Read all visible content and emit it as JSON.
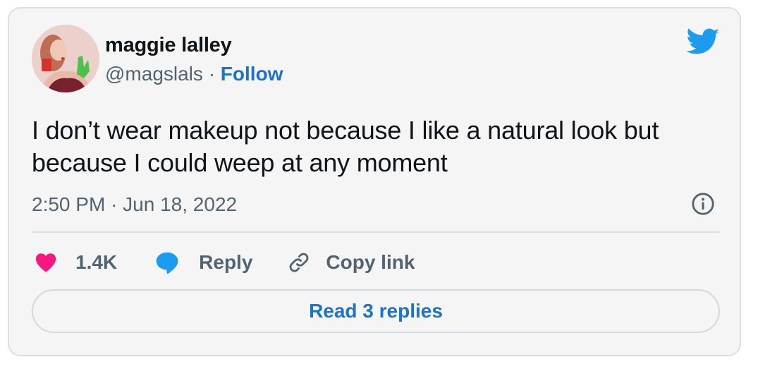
{
  "author": {
    "name": "maggie lalley",
    "handle": "@magslals",
    "separator": "·",
    "follow_label": "Follow"
  },
  "tweet": {
    "text_line1": "I don’t wear makeup not because I like a natural look but",
    "text_line2": "because I could weep at any moment",
    "time": "2:50 PM",
    "separator": "·",
    "date": "Jun 18, 2022"
  },
  "actions": {
    "like_count": "1.4K",
    "reply_label": "Reply",
    "copy_label": "Copy link"
  },
  "read_replies_label": "Read 3 replies",
  "colors": {
    "brand_blue": "#1d9bf0",
    "link_blue": "#1d73c9",
    "heart": "#f91880",
    "text_primary": "#0f1419",
    "text_secondary": "#536471",
    "card_bg": "#f5f5f5",
    "border": "#dcdfe2"
  },
  "icons": {
    "brand": "twitter-bird-icon",
    "info": "info-circle-icon",
    "like": "heart-icon",
    "reply": "speech-bubble-icon",
    "copy": "link-icon"
  }
}
